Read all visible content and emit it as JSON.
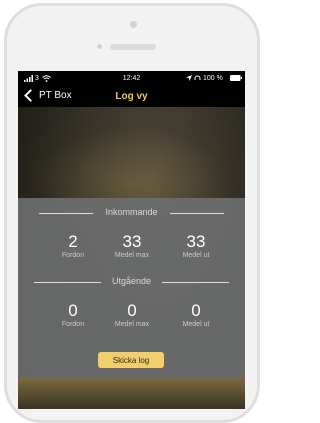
{
  "status_bar": {
    "signal": "3",
    "time": "12:42",
    "battery": "100 %"
  },
  "nav": {
    "back_label": "PT Box",
    "title": "Log vy"
  },
  "incoming": {
    "header": "Inkommande",
    "stats": [
      {
        "value": "2",
        "caption": "Fordon"
      },
      {
        "value": "33",
        "caption": "Medel max"
      },
      {
        "value": "33",
        "caption": "Medel ut"
      }
    ]
  },
  "outgoing": {
    "header": "Utgående",
    "stats": [
      {
        "value": "0",
        "caption": "Fordon"
      },
      {
        "value": "0",
        "caption": "Medel max"
      },
      {
        "value": "0",
        "caption": "Medel ut"
      }
    ]
  },
  "actions": {
    "send_log_label": "Skicka log"
  },
  "colors": {
    "accent": "#f2c94c",
    "panel": "#6c6e6e",
    "button": "#f2cf6b"
  },
  "icons": [
    "signal-icon",
    "wifi-icon",
    "location-icon",
    "headphones-icon",
    "battery-icon",
    "chevron-left-icon"
  ]
}
